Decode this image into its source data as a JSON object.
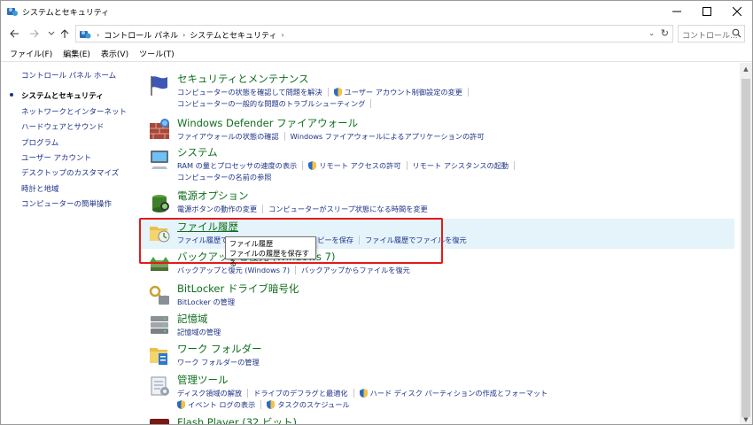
{
  "window": {
    "title": "システムとセキュリティ"
  },
  "address": {
    "breadcrumb": [
      "コントロール パネル",
      "システムとセキュリティ"
    ],
    "search_placeholder": "コントロール..."
  },
  "menu": [
    "ファイル(F)",
    "編集(E)",
    "表示(V)",
    "ツール(T)"
  ],
  "leftnav": {
    "home": "コントロール パネル ホーム",
    "items": [
      "システムとセキュリティ",
      "ネットワークとインターネット",
      "ハードウェアとサウンド",
      "プログラム",
      "ユーザー アカウント",
      "デスクトップのカスタマイズ",
      "時計と地域",
      "コンピューターの簡単操作"
    ]
  },
  "categories": [
    {
      "title": "セキュリティとメンテナンス",
      "line1": [
        "コンピューターの状態を確認して問題を解決",
        "ユーザー アカウント制御設定の変更"
      ],
      "line2": [
        "コンピューターの一般的な問題のトラブルシューティング"
      ]
    },
    {
      "title": "Windows Defender ファイアウォール",
      "line1": [
        "ファイアウォールの状態の確認",
        "Windows ファイアウォールによるアプリケーションの許可"
      ]
    },
    {
      "title": "システム",
      "line1": [
        "RAM の量とプロセッサの速度の表示",
        "リモート アクセスの許可",
        "リモート アシスタンスの起動"
      ],
      "line2": [
        "コンピューターの名前の参照"
      ]
    },
    {
      "title": "電源オプション",
      "line1": [
        "電源ボタンの動作の変更",
        "コンピューターがスリープ状態になる時間を変更"
      ]
    },
    {
      "title": "ファイル履歴",
      "line1": [
        "ファイル履歴でファイルのバックアップ コピーを保存",
        "ファイル履歴でファイルを復元"
      ]
    },
    {
      "title": "バックアップと復元 (Windows 7)",
      "line1": [
        "バックアップと復元 (Windows 7)",
        "バックアップからファイルを復元"
      ]
    },
    {
      "title": "BitLocker ドライブ暗号化",
      "line1": [
        "BitLocker の管理"
      ]
    },
    {
      "title": "記憶域",
      "line1": [
        "記憶域の管理"
      ]
    },
    {
      "title": "ワーク フォルダー",
      "line1": [
        "ワーク フォルダーの管理"
      ]
    },
    {
      "title": "管理ツール",
      "line1": [
        "ディスク領域の解放",
        "ドライブのデフラグと最適化",
        "ハード ディスク パーティションの作成とフォーマット"
      ],
      "line2": [
        "イベント ログの表示",
        "タスクのスケジュール"
      ]
    },
    {
      "title": "Flash Player (32 ビット)"
    }
  ],
  "tooltip": {
    "title": "ファイル履歴",
    "desc": "ファイルの履歴を保存する"
  },
  "colors": {
    "link": "#1e3287",
    "category_title": "#0f6e1d",
    "highlight_row": "#e5f3fb",
    "annotation_box": "#e21b1b"
  }
}
